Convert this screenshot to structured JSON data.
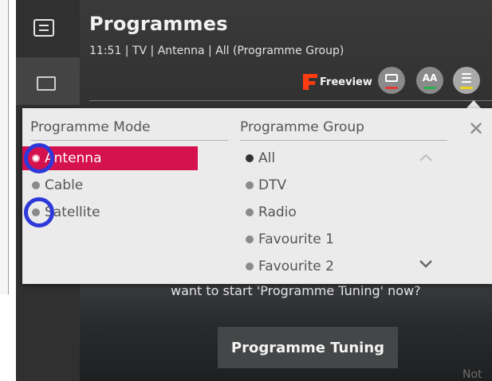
{
  "header": {
    "title": "Programmes",
    "subtitle": "11:51 | TV | Antenna | All (Programme Group)"
  },
  "toolbar": {
    "brand": "Freeview",
    "aa_label": "AA"
  },
  "panel": {
    "mode_heading": "Programme Mode",
    "group_heading": "Programme Group",
    "close_glyph": "✕",
    "modes": [
      {
        "label": "Antenna",
        "selected": true
      },
      {
        "label": "Cable",
        "selected": false
      },
      {
        "label": "Satellite",
        "selected": false
      }
    ],
    "groups": [
      {
        "label": "All",
        "selected": true
      },
      {
        "label": "DTV",
        "selected": false
      },
      {
        "label": "Radio",
        "selected": false
      },
      {
        "label": "Favourite 1",
        "selected": false
      },
      {
        "label": "Favourite 2",
        "selected": false
      }
    ]
  },
  "dialog": {
    "prompt": "want to start 'Programme Tuning' now?",
    "tuning_button": "Programme Tuning",
    "bottom_partial": "Not S"
  },
  "colors": {
    "accent": "#d6124e",
    "annotation_ring": "#2d39d8",
    "freeview_orange": "#ff3b12",
    "subs_red": "#e23a3a",
    "aa_green": "#2db04f",
    "list_yellow": "#f0d21a"
  },
  "icons": [
    "menu-icon",
    "tv-icon",
    "subtitles-icon",
    "text-size-icon",
    "list-icon",
    "close-icon",
    "chevron-up-icon",
    "chevron-down-icon"
  ]
}
